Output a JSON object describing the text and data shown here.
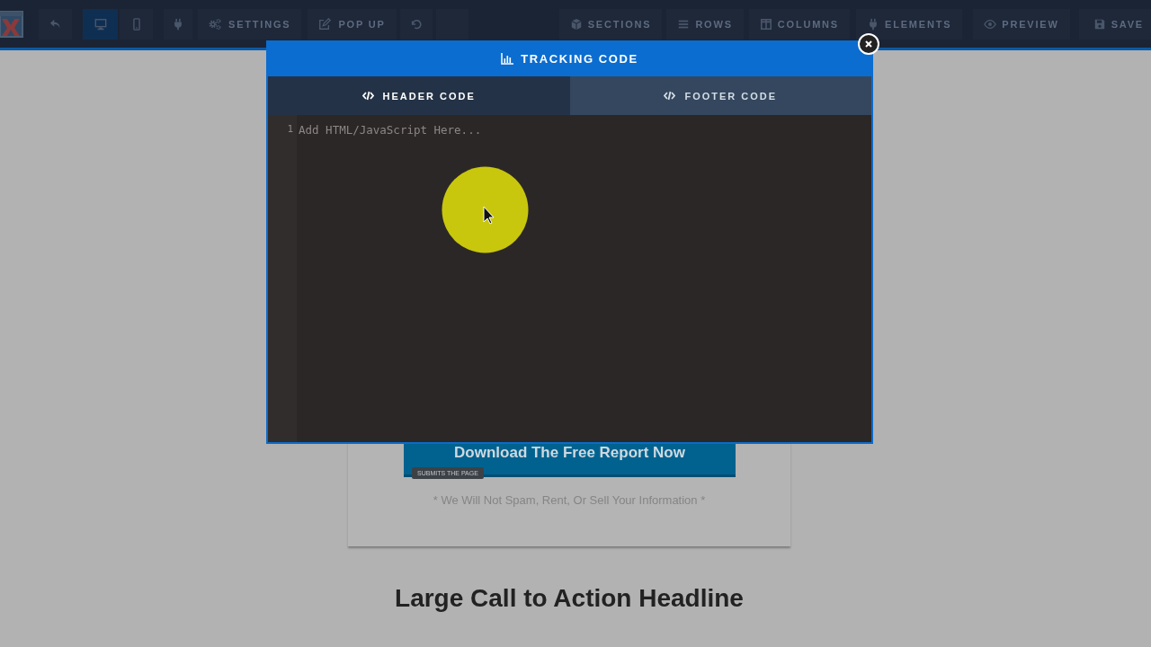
{
  "toolbar": {
    "device_toggle": [
      {
        "selected": true
      },
      {
        "selected": false
      }
    ],
    "left_buttons": [
      {
        "label": "SETTINGS"
      },
      {
        "label": "POP UP"
      }
    ],
    "right_buttons": [
      {
        "label": "SECTIONS"
      },
      {
        "label": "ROWS"
      },
      {
        "label": "COLUMNS"
      },
      {
        "label": "ELEMENTS"
      },
      {
        "label": "PREVIEW"
      },
      {
        "label": "SAVE"
      }
    ]
  },
  "page": {
    "optin_card": {
      "submit_button": {
        "label": "Download The Free Report Now",
        "badge": "SUBMITS THE PAGE"
      },
      "privacy_note": "* We Will Not Spam, Rent, Or Sell Your Information *"
    },
    "headline": "Large Call to Action Headline"
  },
  "modal": {
    "title": "TRACKING CODE",
    "tabs": [
      {
        "label": "HEADER CODE",
        "selected": true
      },
      {
        "label": "FOOTER CODE",
        "selected": false
      }
    ],
    "editor": {
      "line_numbers": [
        "1"
      ],
      "placeholder": "Add HTML/JavaScript Here..."
    }
  }
}
